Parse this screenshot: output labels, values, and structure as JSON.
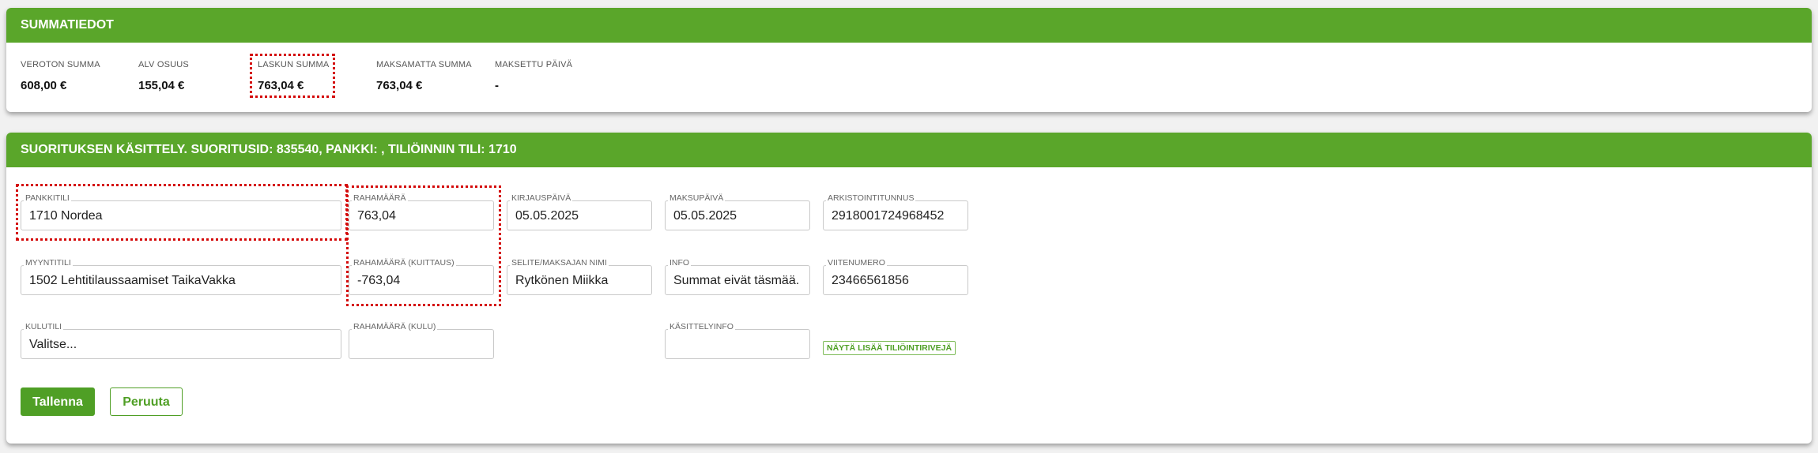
{
  "summary": {
    "title": "SUMMATIEDOT",
    "items": [
      {
        "label": "VEROTON SUMMA",
        "value": "608,00 €"
      },
      {
        "label": "ALV OSUUS",
        "value": "155,04 €"
      },
      {
        "label": "LASKUN SUMMA",
        "value": "763,04 €"
      },
      {
        "label": "MAKSAMATTA SUMMA",
        "value": "763,04 €"
      },
      {
        "label": "MAKSETTU PÄIVÄ",
        "value": "-"
      }
    ]
  },
  "payment": {
    "title": "SUORITUKSEN KÄSITTELY. SUORITUSID: 835540, PANKKI: , TILIÖINNIN TILI: 1710",
    "fields": {
      "pankkitili": {
        "label": "PANKKITILI",
        "value": "1710 Nordea"
      },
      "rahamaara": {
        "label": "RAHAMÄÄRÄ",
        "value": "763,04"
      },
      "kirjauspaiva": {
        "label": "KIRJAUSPÄIVÄ",
        "value": "05.05.2025"
      },
      "maksupaiva": {
        "label": "MAKSUPÄIVÄ",
        "value": "05.05.2025"
      },
      "arkistointitunnus": {
        "label": "ARKISTOINTITUNNUS",
        "value": "2918001724968452"
      },
      "myyntitili": {
        "label": "MYYNTITILI",
        "value": "1502 Lehtitilaussaamiset TaikaVakka"
      },
      "rahamaara_kuittaus": {
        "label": "RAHAMÄÄRÄ (KUITTAUS)",
        "value": "-763,04"
      },
      "selite": {
        "label": "SELITE/MAKSAJAN NIMI",
        "value": "Rytkönen Miikka"
      },
      "info": {
        "label": "INFO",
        "value": "Summat eivät täsmää."
      },
      "viitenumero": {
        "label": "VIITENUMERO",
        "value": "23466561856"
      },
      "kulutili": {
        "label": "KULUTILI",
        "value": "Valitse..."
      },
      "rahamaara_kulu": {
        "label": "RAHAMÄÄRÄ (KULU)",
        "value": ""
      },
      "kasittelyinfo": {
        "label": "KÄSITTELYINFO",
        "value": ""
      }
    },
    "more_link": "NÄYTÄ LISÄÄ TILIÖINTIRIVEJÄ",
    "save_label": "Tallenna",
    "cancel_label": "Peruuta"
  },
  "colors": {
    "header_green": "#5aa62a",
    "button_green": "#4f9f25",
    "highlight_red": "#d40a0a"
  }
}
